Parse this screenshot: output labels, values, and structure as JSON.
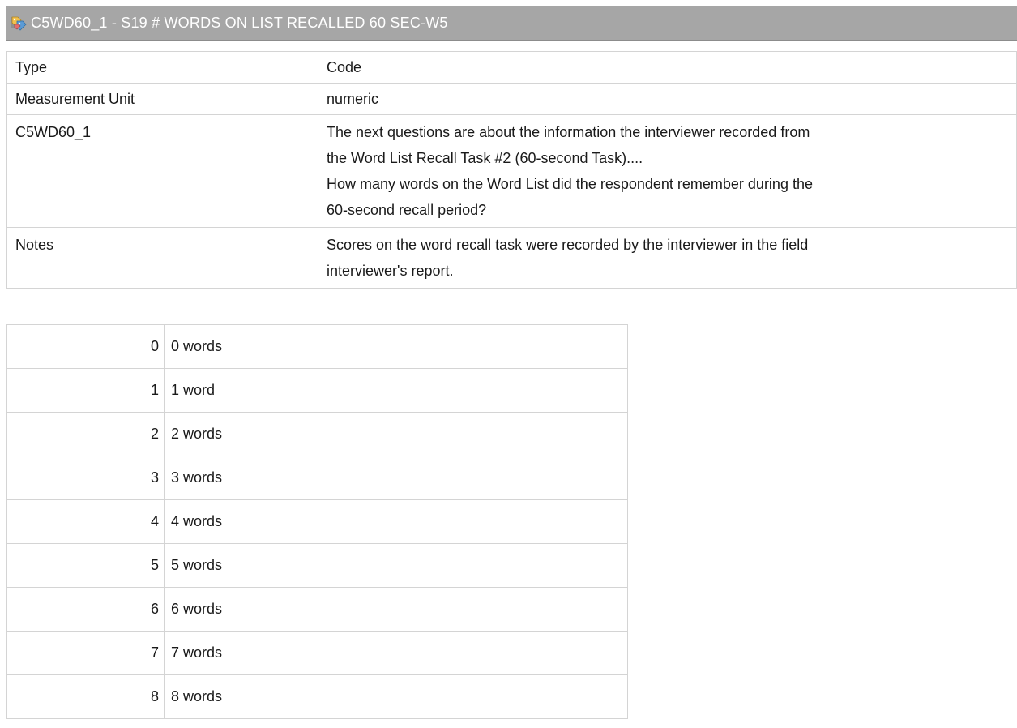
{
  "header": {
    "title": "C5WD60_1 - S19 # WORDS ON LIST RECALLED 60 SEC-W5",
    "icon": "variable-tags-icon"
  },
  "details": [
    {
      "label": "Type",
      "value": [
        "Code"
      ]
    },
    {
      "label": "Measurement Unit",
      "value": [
        "numeric"
      ]
    },
    {
      "label": "C5WD60_1",
      "value": [
        "The next questions are about the information the interviewer recorded from",
        "the Word List Recall Task #2 (60-second Task)....",
        "How many words on the Word List did the respondent remember during the",
        "60-second recall period?"
      ]
    },
    {
      "label": "Notes",
      "value": [
        "Scores on the word recall task were recorded by the interviewer in the field",
        "interviewer's report."
      ]
    }
  ],
  "codes": [
    {
      "code": "0",
      "label": "0 words"
    },
    {
      "code": "1",
      "label": "1 word"
    },
    {
      "code": "2",
      "label": "2 words"
    },
    {
      "code": "3",
      "label": "3 words"
    },
    {
      "code": "4",
      "label": "4 words"
    },
    {
      "code": "5",
      "label": "5 words"
    },
    {
      "code": "6",
      "label": "6 words"
    },
    {
      "code": "7",
      "label": "7 words"
    },
    {
      "code": "8",
      "label": "8 words"
    }
  ]
}
